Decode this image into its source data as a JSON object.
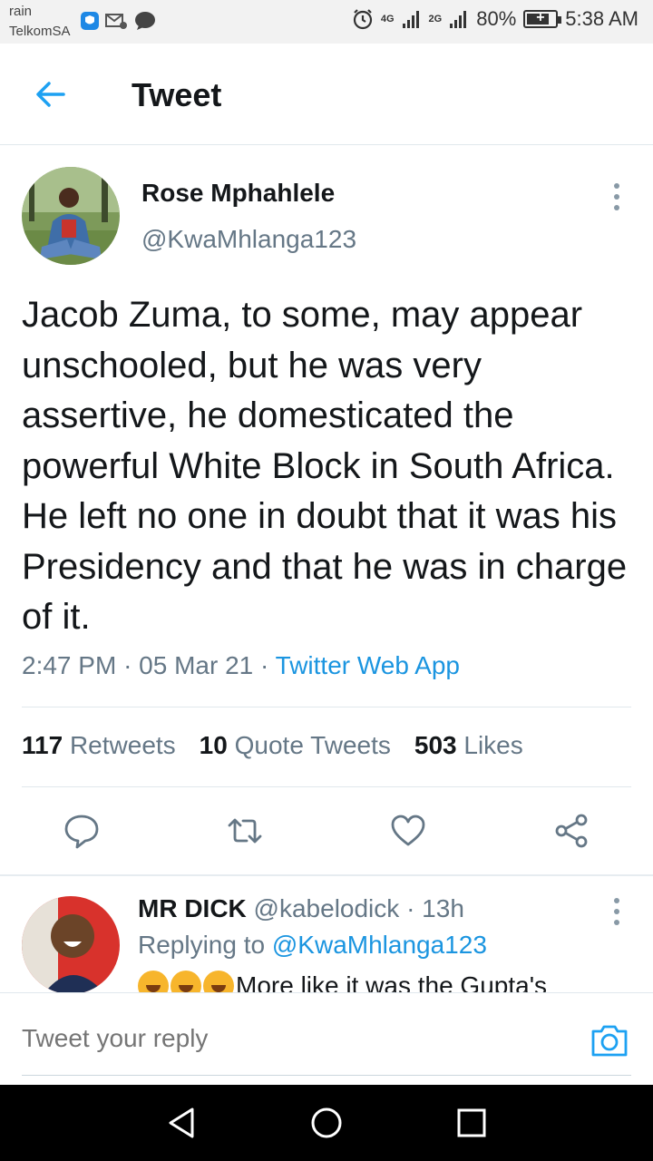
{
  "status_bar": {
    "carrier_top": "rain",
    "carrier_bottom": "TelkomSA",
    "network_4g": "4G",
    "network_2g": "2G",
    "battery_percent": "80%",
    "battery_level": 0.8,
    "time": "5:38 AM"
  },
  "header": {
    "title": "Tweet"
  },
  "tweet": {
    "author_name": "Rose Mphahlele",
    "author_handle": "@KwaMhlanga123",
    "text": "Jacob Zuma, to some, may appear unschooled, but he was very assertive, he domesticated the powerful White Block in South Africa. He left no one in doubt that it was his Presidency and that he was in charge of it.",
    "time": "2:47 PM",
    "date": "05 Mar 21",
    "separator": "·",
    "source": "Twitter Web App",
    "retweets_count": "117",
    "retweets_label": "Retweets",
    "quotes_count": "10",
    "quotes_label": "Quote Tweets",
    "likes_count": "503",
    "likes_label": "Likes"
  },
  "reply": {
    "name": "MR DICK",
    "handle": "@kabelodick",
    "separator": "·",
    "age": "13h",
    "replying_label": "Replying to",
    "replying_handle": "@KwaMhlanga123",
    "text": "More like it was the Gupta's"
  },
  "composer": {
    "placeholder": "Tweet your reply"
  },
  "icons": {
    "back": "arrow-left-icon",
    "more": "more-vertical-icon",
    "reply": "comment-icon",
    "retweet": "retweet-icon",
    "like": "heart-icon",
    "share": "share-icon",
    "camera": "camera-icon"
  },
  "colors": {
    "accent": "#1da1f2",
    "link": "#1b95e0",
    "secondary_text": "#657786",
    "primary_text": "#14171a"
  }
}
